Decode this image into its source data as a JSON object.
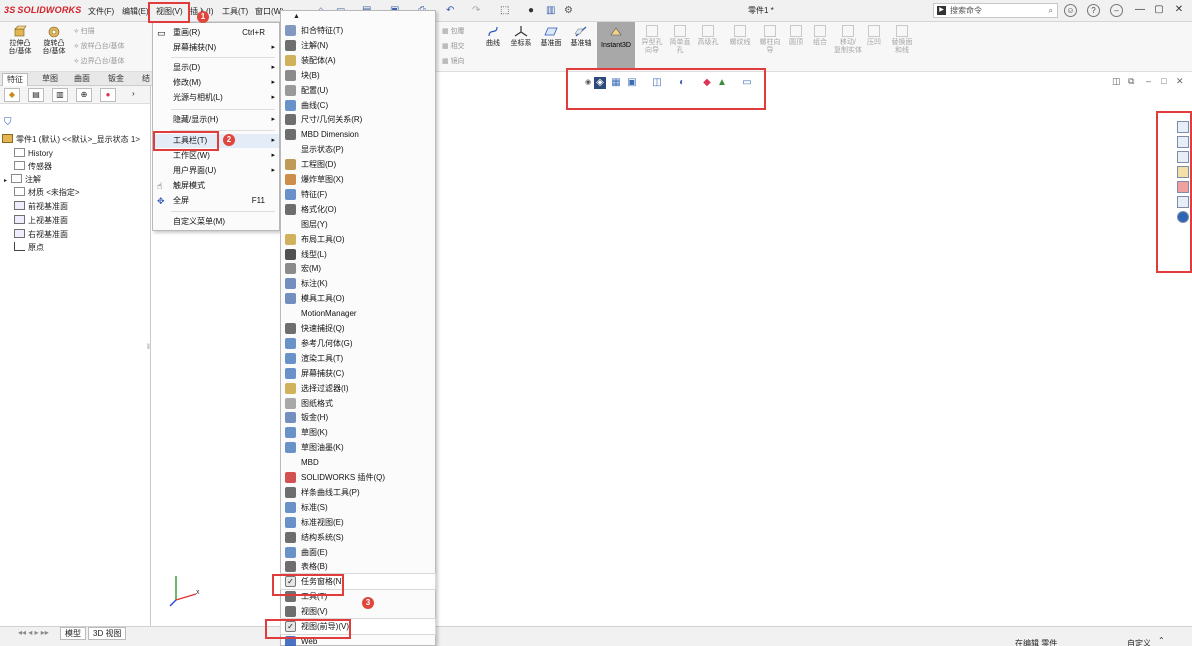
{
  "app": {
    "logo": "SOLIDWORKS",
    "logo_prefix": "3S",
    "document_title": "零件1 *",
    "menu": [
      "文件(F)",
      "编辑(E)",
      "视图(V)",
      "插入(I)",
      "工具(T)",
      "窗口(W)"
    ],
    "search_placeholder": "搜索命令",
    "help_icons": [
      "user-icon",
      "help-icon",
      "minimize-icon"
    ],
    "window_buttons": [
      "—",
      "▢",
      "✕"
    ]
  },
  "command_manager": {
    "large_buttons": [
      {
        "label": "拉伸凸\n台/基体"
      },
      {
        "label": "旋转凸\n台/基体"
      }
    ],
    "small_buttons": [
      "扫描",
      "放样凸台/基体",
      "边界凸台/基体"
    ],
    "right_small": [
      "包覆",
      "相交",
      "镜向"
    ],
    "feature_buttons": [
      {
        "label": "曲线"
      },
      {
        "label": "坐标系"
      },
      {
        "label": "基准面"
      },
      {
        "label": "基准轴"
      },
      {
        "label": "Instant3D"
      }
    ],
    "faded_buttons": [
      "异型孔\n向导",
      "简单直\n孔",
      "高级孔",
      "螺纹线",
      "螺柱向\n导",
      "圆顶",
      "组合",
      "移动/\n复制实体",
      "压凹",
      "替换面\n和线"
    ]
  },
  "tabs": {
    "items": [
      "特征",
      "草图",
      "曲面",
      "钣金",
      "结"
    ]
  },
  "feature_tree": {
    "root": "零件1 (默认) <<默认>_显示状态 1>",
    "items": [
      {
        "label": "History",
        "icon": "history-icon"
      },
      {
        "label": "传感器",
        "icon": "sensor-icon"
      },
      {
        "label": "注解",
        "icon": "annotation-icon"
      },
      {
        "label": "材质 <未指定>",
        "icon": "material-icon"
      },
      {
        "label": "前视基准面",
        "icon": "plane-icon"
      },
      {
        "label": "上视基准面",
        "icon": "plane-icon"
      },
      {
        "label": "右视基准面",
        "icon": "plane-icon"
      },
      {
        "label": "原点",
        "icon": "origin-icon"
      }
    ]
  },
  "view_menu": {
    "items": [
      {
        "label": "重画(R)",
        "shortcut": "Ctrl+R",
        "icon": "redraw-icon"
      },
      {
        "label": "屏幕捕获(N)",
        "arrow": true
      },
      {
        "label": "显示(D)",
        "arrow": true
      },
      {
        "label": "修改(M)",
        "arrow": true
      },
      {
        "label": "光源与相机(L)",
        "arrow": true
      },
      {
        "label": "隐藏/显示(H)",
        "arrow": true
      },
      {
        "label": "工具栏(T)",
        "arrow": true
      },
      {
        "label": "工作区(W)",
        "arrow": true
      },
      {
        "label": "用户界面(U)",
        "arrow": true
      },
      {
        "label": "触屏模式",
        "icon": "touch-icon"
      },
      {
        "label": "全屏",
        "shortcut": "F11",
        "icon": "fullscreen-icon"
      },
      {
        "label": "自定义菜单(M)"
      }
    ]
  },
  "toolbar_menu": {
    "items": [
      {
        "label": "扣合特征(T)",
        "icon": "#6b87b6"
      },
      {
        "label": "注解(N)",
        "icon": "#555"
      },
      {
        "label": "装配体(A)",
        "icon": "#c9a33f"
      },
      {
        "label": "块(B)",
        "icon": "#777"
      },
      {
        "label": "配置(U)",
        "icon": "#888"
      },
      {
        "label": "曲线(C)",
        "icon": "#4f7fbf"
      },
      {
        "label": "尺寸/几何关系(R)",
        "icon": "#555"
      },
      {
        "label": "MBD Dimension",
        "icon": "#555"
      },
      {
        "label": "显示状态(P)",
        "icon": ""
      },
      {
        "label": "工程图(D)",
        "icon": "#b58a3a"
      },
      {
        "label": "爆炸草图(X)",
        "icon": "#c47a2a"
      },
      {
        "label": "特征(F)",
        "icon": "#4f7fbf"
      },
      {
        "label": "格式化(O)",
        "icon": "#555"
      },
      {
        "label": "图层(Y)",
        "icon": ""
      },
      {
        "label": "布局工具(O)",
        "icon": "#c9a33f"
      },
      {
        "label": "线型(L)",
        "icon": "#333"
      },
      {
        "label": "宏(M)",
        "icon": "#777"
      },
      {
        "label": "标注(K)",
        "icon": "#5a7bb5"
      },
      {
        "label": "模具工具(O)",
        "icon": "#5a7bb5"
      },
      {
        "label": "MotionManager",
        "icon": ""
      },
      {
        "label": "快速捕捉(Q)",
        "icon": "#555"
      },
      {
        "label": "参考几何体(G)",
        "icon": "#4f7fbf"
      },
      {
        "label": "渲染工具(T)",
        "icon": "#4f7fbf"
      },
      {
        "label": "屏幕捕获(C)",
        "icon": "#4f7fbf"
      },
      {
        "label": "选择过滤器(I)",
        "icon": "#c9a33f"
      },
      {
        "label": "图纸格式",
        "icon": "#999"
      },
      {
        "label": "钣金(H)",
        "icon": "#5a7bb5"
      },
      {
        "label": "草图(K)",
        "icon": "#4f7fbf"
      },
      {
        "label": "草图油墨(K)",
        "icon": "#4f7fbf"
      },
      {
        "label": "MBD",
        "icon": ""
      },
      {
        "label": "SOLIDWORKS 插件(Q)",
        "icon": "#c33"
      },
      {
        "label": "样条曲线工具(P)",
        "icon": "#555"
      },
      {
        "label": "标准(S)",
        "icon": "#4f7fbf"
      },
      {
        "label": "标准视图(E)",
        "icon": "#4f7fbf"
      },
      {
        "label": "结构系统(S)",
        "icon": "#555"
      },
      {
        "label": "曲面(E)",
        "icon": "#4f7fbf"
      },
      {
        "label": "表格(B)",
        "icon": "#555"
      },
      {
        "label": "任务窗格(N)",
        "icon": "check",
        "checked": true
      },
      {
        "label": "工具(T)",
        "icon": "#555"
      },
      {
        "label": "视图(V)",
        "icon": "#555"
      },
      {
        "label": "视图(前导)(V)",
        "icon": "check",
        "checked": true
      },
      {
        "label": "Web",
        "icon": "#2a5ab8"
      }
    ]
  },
  "badges": [
    "1",
    "2",
    "3"
  ],
  "status_bar": {
    "tabs": [
      "模型",
      "3D 视图"
    ],
    "status": "在编辑 零件",
    "units": "自定义"
  },
  "colors": {
    "accent_red": "#e03c3c",
    "solidworks_red": "#d3202a",
    "instant3d_active": "#a8a8a8"
  }
}
